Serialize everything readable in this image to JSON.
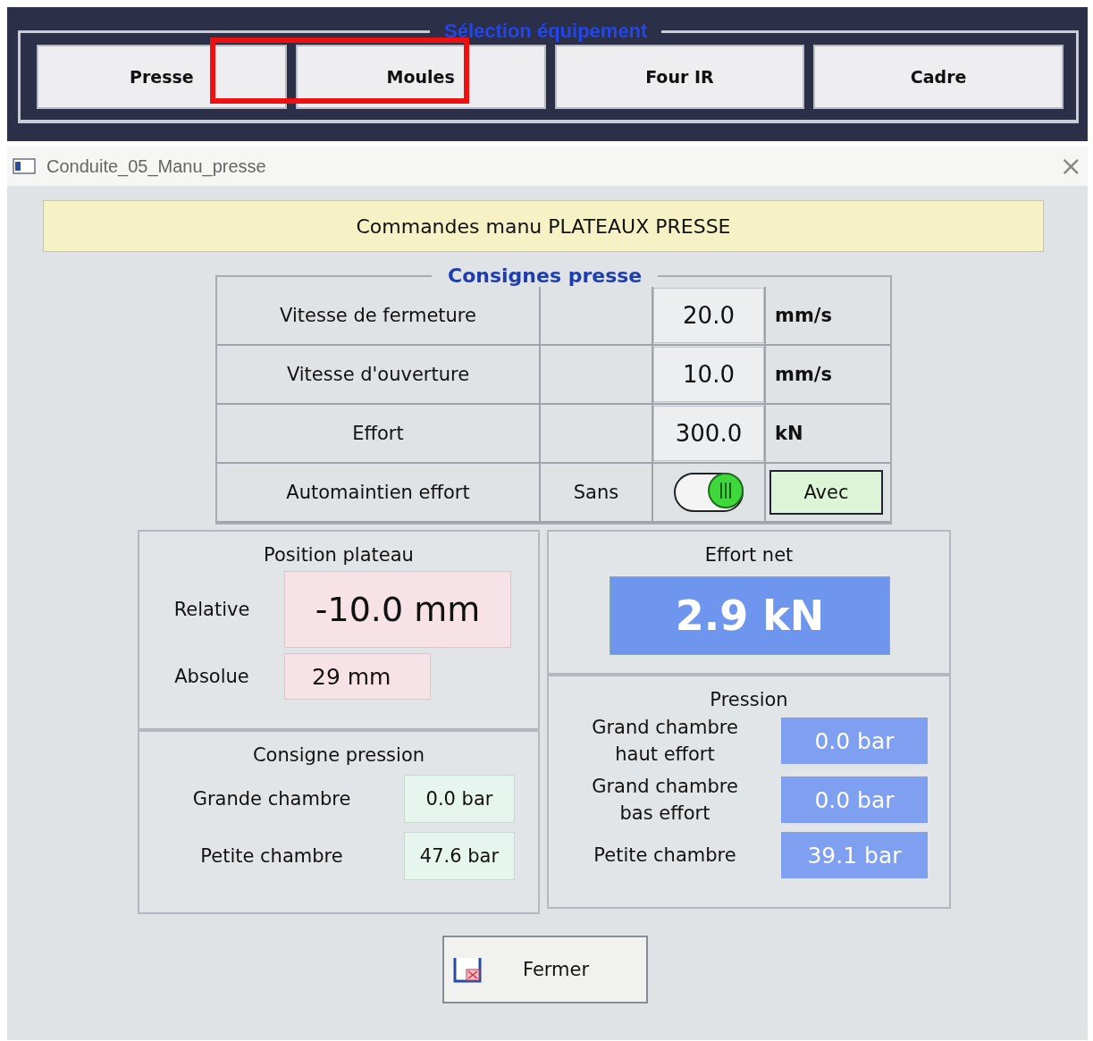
{
  "equipment_selection": {
    "title": "Sélection équipement",
    "buttons": [
      {
        "label": "Presse",
        "highlighted": false
      },
      {
        "label": "Moules",
        "highlighted": true
      },
      {
        "label": "Four IR",
        "highlighted": false
      },
      {
        "label": "Cadre",
        "highlighted": false
      }
    ]
  },
  "window": {
    "title": "Conduite_05_Manu_presse",
    "close": "×"
  },
  "banner": "Commandes manu PLATEAUX PRESSE",
  "setpoints": {
    "title": "Consignes presse",
    "rows": [
      {
        "kind": "value",
        "label": "Vitesse de fermeture",
        "value": "20.0",
        "unit": "mm/s"
      },
      {
        "kind": "value",
        "label": "Vitesse d'ouverture",
        "value": "10.0",
        "unit": "mm/s"
      },
      {
        "kind": "value",
        "label": "Effort",
        "value": "300.0",
        "unit": "kN"
      },
      {
        "kind": "toggle",
        "label": "Automaintien effort",
        "off_label": "Sans",
        "on_label": "Avec",
        "on": true
      }
    ]
  },
  "position": {
    "title": "Position plateau",
    "relative_label": "Relative",
    "relative": "-10.0 mm",
    "absolute_label": "Absolue",
    "absolute": "29 mm"
  },
  "pressure_setpoint": {
    "title": "Consigne pression",
    "rows": [
      {
        "label": "Grande chambre",
        "value": "0.0 bar"
      },
      {
        "label": "Petite chambre",
        "value": "47.6 bar"
      }
    ]
  },
  "net_force": {
    "title": "Effort net",
    "value": "2.9 kN"
  },
  "pressure": {
    "title": "Pression",
    "rows": [
      {
        "label": "Grand chambre haut effort",
        "value": "0.0 bar"
      },
      {
        "label": "Grand chambre bas effort",
        "value": "0.0 bar"
      },
      {
        "label": "Petite chambre",
        "value": "39.1 bar"
      }
    ]
  },
  "close_button": "Fermer"
}
